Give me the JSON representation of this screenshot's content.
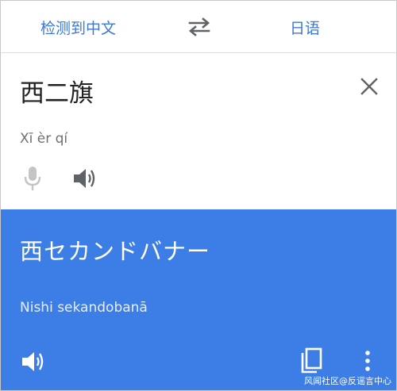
{
  "language_bar": {
    "source_language": "检测到中文",
    "target_language": "日语",
    "swap_icon": "swap-arrows-icon"
  },
  "input": {
    "text": "西二旗",
    "romanization": "Xī èr qí",
    "icons": [
      "close-icon",
      "microphone-icon",
      "speaker-icon"
    ]
  },
  "output": {
    "text": "西セカンドバナー",
    "romanization": "Nishi sekandobanā",
    "icons": [
      "speaker-icon",
      "copy-icon",
      "more-vert-icon"
    ]
  },
  "watermark": "风闻社区@反谣言中心",
  "colors": {
    "accent": "#3c78d8",
    "output_background": "#3d7ee6",
    "disabled_icon": "#c4c4c4",
    "icon": "#5f6368"
  }
}
